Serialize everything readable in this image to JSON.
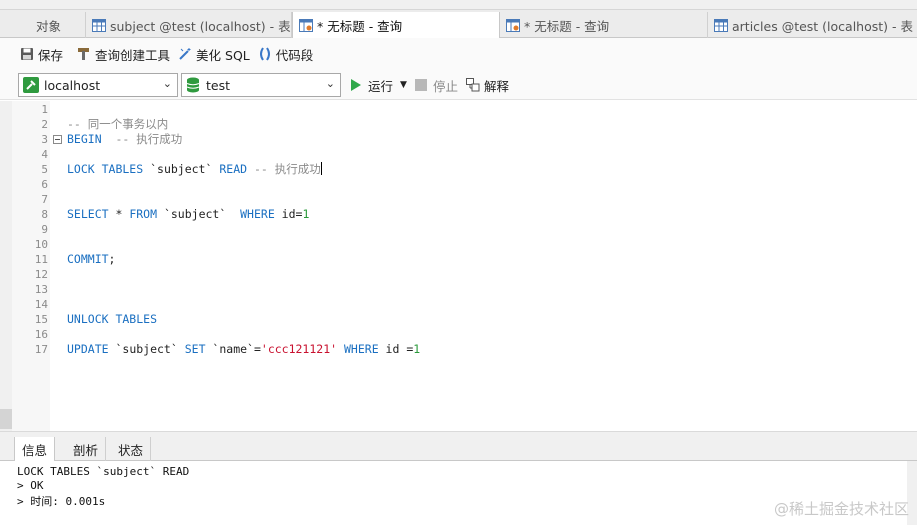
{
  "tabs": [
    {
      "label": "对象",
      "icon": "none",
      "active": false
    },
    {
      "label": "subject @test (localhost) - 表",
      "icon": "table-icon",
      "active": false
    },
    {
      "label": "* 无标题 - 查询",
      "icon": "query-icon",
      "active": true
    },
    {
      "label": "* 无标题 - 查询",
      "icon": "query-icon",
      "active": false
    },
    {
      "label": "articles @test (localhost) - 表",
      "icon": "table-icon",
      "active": false
    }
  ],
  "toolbar": {
    "save": "保存",
    "query_builder": "查询创建工具",
    "beautify": "美化 SQL",
    "snippet": "代码段"
  },
  "connection": {
    "value": "localhost"
  },
  "database": {
    "value": "test"
  },
  "actions": {
    "run": "运行",
    "stop": "停止",
    "explain": "解释"
  },
  "editor": {
    "line_numbers": [
      "1",
      "2",
      "3",
      "4",
      "5",
      "6",
      "7",
      "8",
      "9",
      "10",
      "11",
      "12",
      "13",
      "14",
      "15",
      "16",
      "17"
    ],
    "lines": {
      "l2": "-- 同一个事务以内",
      "l3_kw": "BEGIN",
      "l3_cm": "  -- 执行成功",
      "l5_kw1": "LOCK TABLES",
      "l5_tbl": " `subject` ",
      "l5_kw2": "READ",
      "l5_cm": " -- 执行成功",
      "l8_kw1": "SELECT",
      "l8_mid": " * ",
      "l8_kw2": "FROM",
      "l8_tbl": " `subject`  ",
      "l8_kw3": "WHERE",
      "l8_cond": " id=",
      "l8_num": "1",
      "l11_kw": "COMMIT",
      "l11_end": ";",
      "l15_kw": "UNLOCK TABLES",
      "l17_kw1": "UPDATE",
      "l17_tbl": " `subject` ",
      "l17_kw2": "SET",
      "l17_col": " `name`=",
      "l17_str": "'ccc121121'",
      "l17_sp": " ",
      "l17_kw3": "WHERE",
      "l17_cond": " id =",
      "l17_num": "1"
    }
  },
  "result_tabs": [
    "信息",
    "剖析",
    "状态"
  ],
  "result_lines": [
    "LOCK TABLES `subject` READ",
    "> OK",
    "> 时间: 0.001s"
  ],
  "watermark": "@稀土掘金技术社区"
}
